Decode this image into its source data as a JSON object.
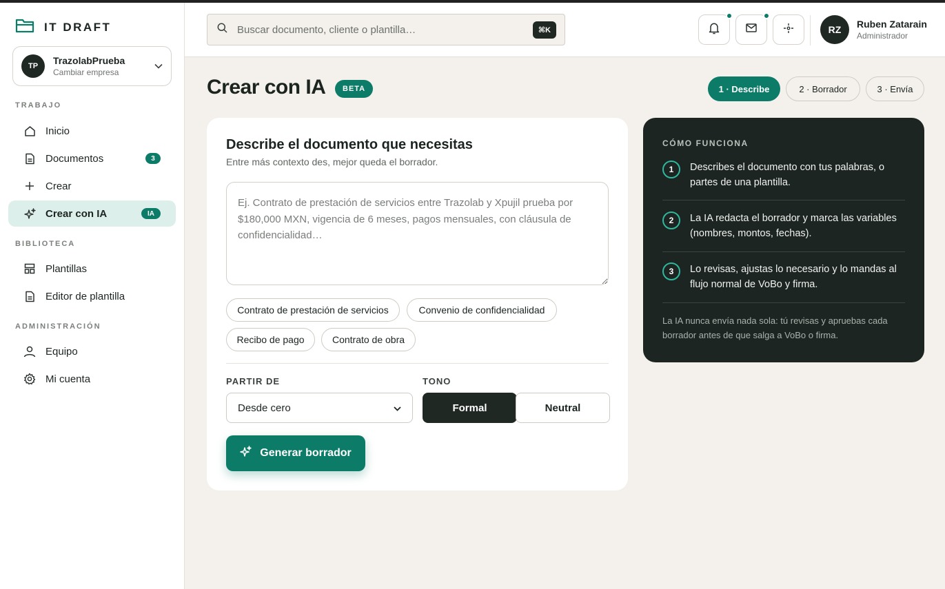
{
  "brand": {
    "name": "IT DRAFT"
  },
  "company": {
    "initials": "TP",
    "name": "TrazolabPrueba",
    "switch_label": "Cambiar empresa"
  },
  "sidebar": {
    "sections": [
      {
        "label": "TRABAJO"
      },
      {
        "label": "BIBLIOTECA"
      },
      {
        "label": "ADMINISTRACIÓN"
      }
    ],
    "items": [
      {
        "label": "Inicio",
        "icon": "home-icon"
      },
      {
        "label": "Documentos",
        "icon": "document-icon",
        "badge": "3"
      },
      {
        "label": "Crear",
        "icon": "plus-icon"
      },
      {
        "label": "Crear con IA",
        "icon": "sparkle-icon",
        "badge": "IA",
        "active": true
      },
      {
        "label": "Plantillas",
        "icon": "template-icon"
      },
      {
        "label": "Editor de plantilla",
        "icon": "document-icon"
      },
      {
        "label": "Equipo",
        "icon": "user-icon"
      },
      {
        "label": "Mi cuenta",
        "icon": "gear-icon"
      }
    ]
  },
  "header": {
    "search_placeholder": "Buscar documento, cliente o plantilla…",
    "shortcut": "⌘K",
    "user": {
      "initials": "RZ",
      "name": "Ruben Zatarain",
      "role": "Administrador"
    }
  },
  "page": {
    "title": "Crear con IA",
    "badge": "BETA",
    "steps": [
      "1 · Describe",
      "2 · Borrador",
      "3 · Envía"
    ]
  },
  "form": {
    "title": "Describe el documento que necesitas",
    "subtitle": "Entre más contexto des, mejor queda el borrador.",
    "placeholder": "Ej. Contrato de prestación de servicios entre Trazolab y Xpujil prueba por $180,000 MXN, vigencia de 6 meses, pagos mensuales, con cláusula de confidencialidad…",
    "suggestions": [
      "Contrato de prestación de servicios",
      "Convenio de confidencialidad",
      "Recibo de pago",
      "Contrato de obra"
    ],
    "start_label": "PARTIR DE",
    "start_value": "Desde cero",
    "tone_label": "TONO",
    "tone_options": [
      "Formal",
      "Neutral"
    ],
    "tone_selected": "Formal",
    "generate_label": "Generar borrador"
  },
  "info_panel": {
    "title": "CÓMO FUNCIONA",
    "steps": [
      {
        "num": "1",
        "text": "Describes el documento con tus palabras, o partes de una plantilla."
      },
      {
        "num": "2",
        "text": "La IA redacta el borrador y marca las variables (nombres, montos, fechas)."
      },
      {
        "num": "3",
        "text": "Lo revisas, ajustas lo necesario y lo mandas al flujo normal de VoBo y firma."
      }
    ],
    "note": "La IA nunca envía nada sola: tú revisas y apruebas cada borrador antes de que salga a VoBo o firma."
  },
  "colors": {
    "accent": "#0c7c69",
    "dark": "#1c2521",
    "background": "#f4f1ec"
  }
}
